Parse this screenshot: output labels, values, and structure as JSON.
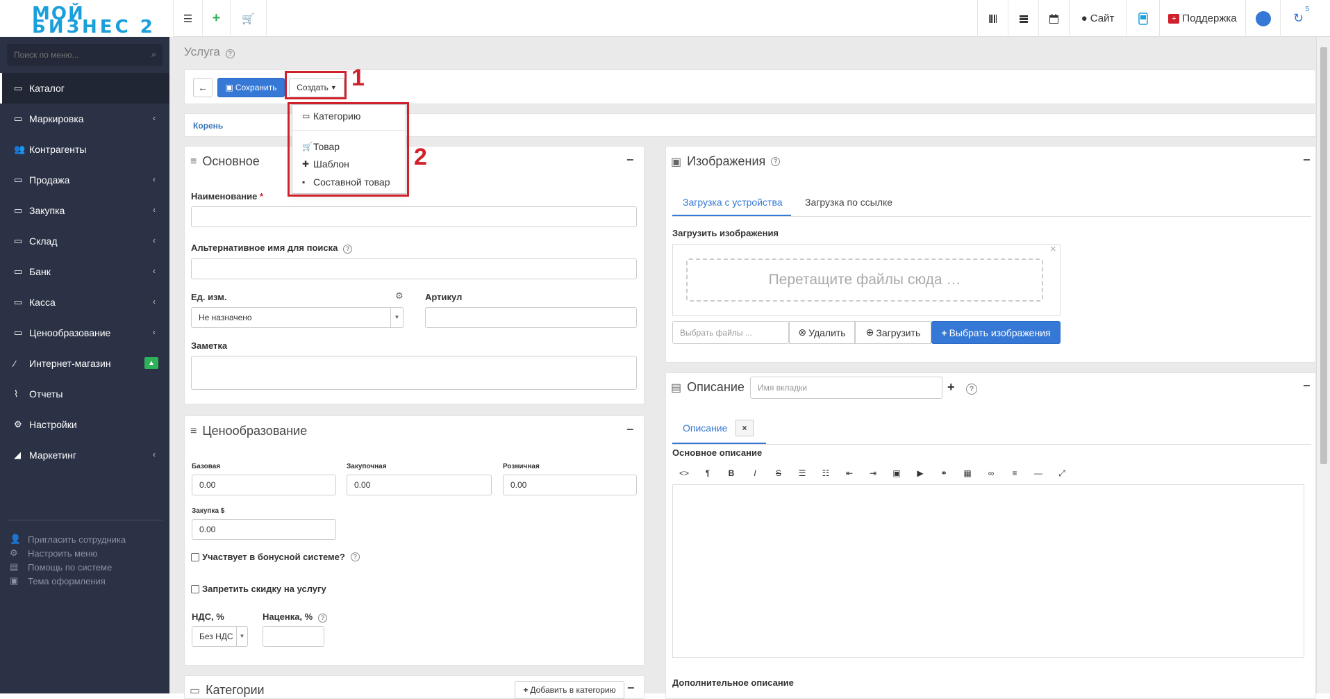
{
  "logo": {
    "line1": "МОЙ",
    "line2": "БИЗНЕС 2"
  },
  "topbar": {
    "menu_icon": "hamburger-icon",
    "add_icon": "plus-icon",
    "cart_icon": "cart-icon",
    "barcode_icon": "barcode-icon",
    "list_icon": "server-icon",
    "calendar_icon": "calendar-icon",
    "site_label": "Сайт",
    "support_label": "Поддержка",
    "notifications_count": "5"
  },
  "sidebar": {
    "search_placeholder": "Поиск по меню...",
    "items": [
      {
        "label": "Каталог",
        "icon": "folder-icon",
        "active": true
      },
      {
        "label": "Маркировка",
        "icon": "folder-icon",
        "chevron": true
      },
      {
        "label": "Контрагенты",
        "icon": "users-icon"
      },
      {
        "label": "Продажа",
        "icon": "folder-icon",
        "chevron": true
      },
      {
        "label": "Закупка",
        "icon": "folder-icon",
        "chevron": true
      },
      {
        "label": "Склад",
        "icon": "folder-icon",
        "chevron": true
      },
      {
        "label": "Банк",
        "icon": "folder-icon",
        "chevron": true
      },
      {
        "label": "Касса",
        "icon": "folder-icon",
        "chevron": true
      },
      {
        "label": "Ценообразование",
        "icon": "folder-icon",
        "chevron": true
      },
      {
        "label": "Интернет-магазин",
        "icon": "wand-icon",
        "badge": true
      },
      {
        "label": "Отчеты",
        "icon": "chart-line-icon"
      },
      {
        "label": "Настройки",
        "icon": "gear-icon"
      },
      {
        "label": "Маркетинг",
        "icon": "chart-area-icon",
        "chevron": true
      }
    ],
    "links": [
      {
        "label": "Пригласить сотрудника",
        "icon": "user-plus-icon"
      },
      {
        "label": "Настроить меню",
        "icon": "cogs-icon"
      },
      {
        "label": "Помощь по системе",
        "icon": "book-icon"
      },
      {
        "label": "Тема оформления",
        "icon": "image-icon"
      }
    ]
  },
  "page": {
    "title": "Услуга"
  },
  "toolbar": {
    "save_label": "Сохранить",
    "create_label": "Создать"
  },
  "annotations": {
    "one": "1",
    "two": "2"
  },
  "create_menu": {
    "items": [
      "Категорию",
      "Товар",
      "Шаблон",
      "Составной товар"
    ]
  },
  "breadcrumb": {
    "root": "Корень"
  },
  "basic": {
    "title": "Основное",
    "name_label": "Наименование",
    "alt_name_label": "Альтернативное имя для поиска",
    "unit_label": "Ед. изм.",
    "unit_value": "Не назначено",
    "sku_label": "Артикул",
    "note_label": "Заметка"
  },
  "pricing": {
    "title": "Ценообразование",
    "base_label": "Базовая",
    "base_value": "0.00",
    "purchase_label": "Закупочная",
    "purchase_value": "0.00",
    "retail_label": "Розничная",
    "retail_value": "0.00",
    "purchase_usd_label": "Закупка $",
    "purchase_usd_value": "0.00",
    "bonus_label": "Участвует в бонусной системе?",
    "no_discount_label": "Запретить скидку на услугу",
    "vat_label": "НДС, %",
    "vat_value": "Без НДС",
    "markup_label": "Наценка, %"
  },
  "categories": {
    "title": "Категории",
    "add_label": "Добавить в категорию"
  },
  "images": {
    "title": "Изображения",
    "tab_upload": "Загрузка с устройства",
    "tab_link": "Загрузка по ссылке",
    "upload_label": "Загрузить изображения",
    "dropzone_text": "Перетащите файлы сюда …",
    "choose_files_placeholder": "Выбрать файлы ...",
    "delete_label": "Удалить",
    "upload_btn_label": "Загрузить",
    "choose_images_label": "Выбрать изображения"
  },
  "description": {
    "title": "Описание",
    "tab_name_placeholder": "Имя вкладки",
    "tab_label": "Описание",
    "main_desc_label": "Основное описание",
    "extra_desc_label": "Дополнительное описание"
  },
  "colors": {
    "accent": "#3578d6",
    "sidebar": "#2b3245",
    "annotation": "#d0202c",
    "badge": "#2fb15a"
  }
}
